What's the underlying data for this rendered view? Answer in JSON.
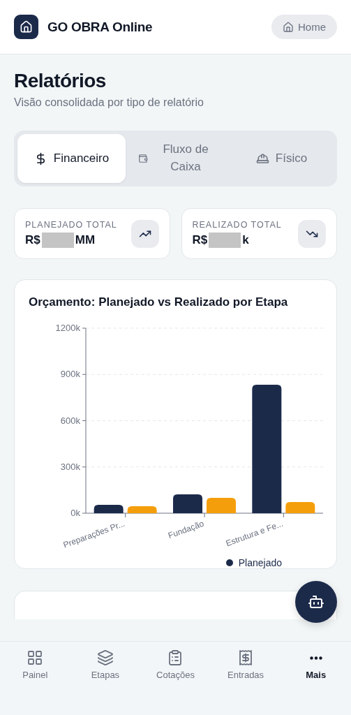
{
  "header": {
    "app_name": "GO OBRA Online",
    "home_button": "Home"
  },
  "page": {
    "title": "Relatórios",
    "subtitle": "Visão consolidada por tipo de relatório"
  },
  "tabs": [
    {
      "kind": "dollar",
      "label": "Financeiro",
      "selected": true
    },
    {
      "kind": "wallet",
      "label": "Fluxo de Caixa",
      "selected": false
    },
    {
      "kind": "helmet",
      "label": "Físico",
      "selected": false
    }
  ],
  "stats": [
    {
      "kind": "up",
      "label": "PLANEJADO TOTAL",
      "prefix": "R$",
      "suffix": "MM",
      "redacted": true
    },
    {
      "kind": "down",
      "label": "REALIZADO TOTAL",
      "prefix": "R$",
      "suffix": "k",
      "redacted": true
    }
  ],
  "chart": {
    "chart_data": {
      "type": "bar",
      "grid": true,
      "title": "Orçamento: Planejado vs Realizado por Etapa",
      "categories": [
        "Preparações Pr...",
        "Fundação",
        "Estrutura e Fe..."
      ],
      "series": [
        {
          "name": "Planejado",
          "color": "#1c2a4a",
          "values": [
            54,
            122,
            833
          ]
        },
        {
          "color": "#f59e0b",
          "values": [
            45,
            100,
            72
          ]
        }
      ],
      "ylim": [
        0,
        1200
      ],
      "yticks": [
        {
          "value": 0,
          "label": "0k"
        },
        {
          "value": 300,
          "label": "300k"
        },
        {
          "value": 600,
          "label": "600k"
        },
        {
          "value": 900,
          "label": "900k"
        },
        {
          "value": 1200,
          "label": "1200k"
        }
      ]
    }
  },
  "nav": [
    {
      "kind": "grid",
      "label": "Painel",
      "selected": false
    },
    {
      "kind": "layers",
      "label": "Etapas",
      "selected": false
    },
    {
      "kind": "clipboard",
      "label": "Cotações",
      "selected": false
    },
    {
      "kind": "receipt",
      "label": "Entradas",
      "selected": false
    },
    {
      "kind": "more",
      "label": "Mais",
      "selected": true
    }
  ]
}
